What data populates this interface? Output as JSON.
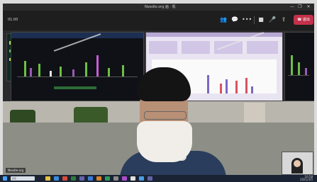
{
  "window": {
    "title": "Needle.org 画 · 凯",
    "minimize": "—",
    "maximize": "❐",
    "close": "✕"
  },
  "toolbar": {
    "elapsed": "01:00",
    "icons": [
      "people-icon",
      "chat-icon",
      "more-icon",
      "camera-icon",
      "mic-icon",
      "share-icon"
    ],
    "leave_label": "退出"
  },
  "meeting": {
    "self_name": "Needle-org"
  },
  "taskbar": {
    "search_placeholder": "搜索",
    "time": "10:58",
    "date": "2021/3/5"
  },
  "colors": {
    "leave": "#c4314b",
    "accent": "#6264a7"
  }
}
